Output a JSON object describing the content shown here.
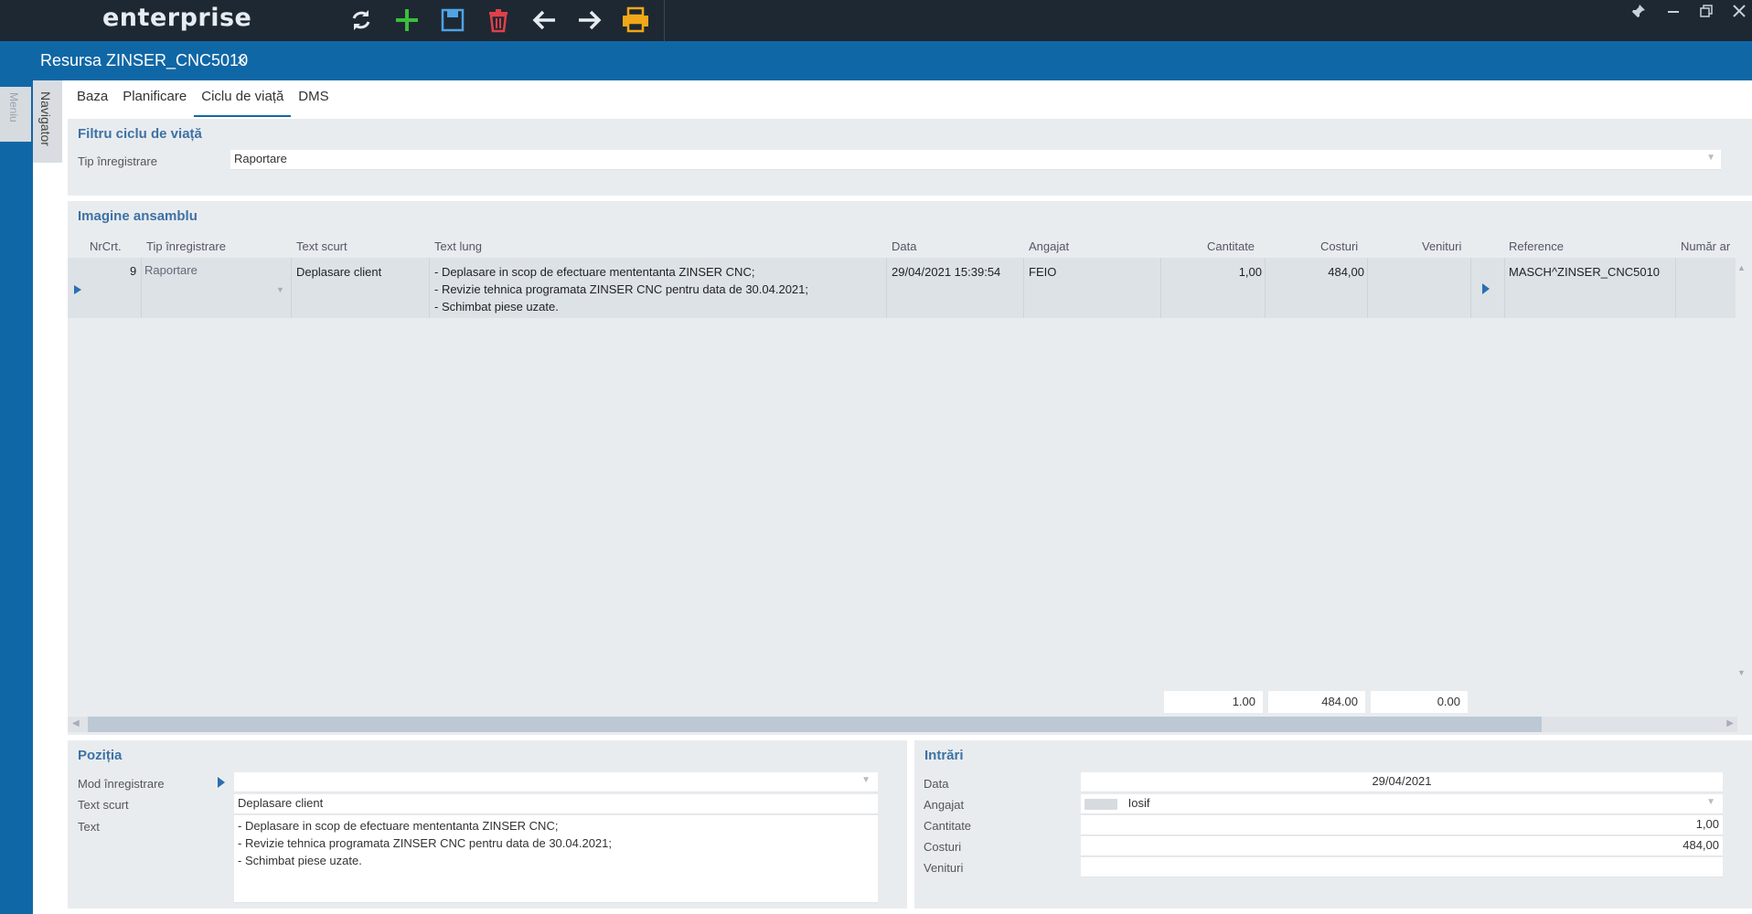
{
  "app": {
    "brand": "enterprise"
  },
  "toolbar": {
    "refresh_icon": "refresh-icon",
    "add_icon": "add-icon",
    "save_icon": "save-icon",
    "delete_icon": "delete-icon",
    "back_icon": "arrow-left-icon",
    "forward_icon": "arrow-right-icon",
    "print_icon": "printer-icon"
  },
  "rail": {
    "tab_label": "Meniu"
  },
  "document": {
    "title": "Resursa ZINSER_CNC5010",
    "close": "×"
  },
  "navigator": {
    "label": "Navigator"
  },
  "tabs": [
    {
      "label": "Baza"
    },
    {
      "label": "Planificare"
    },
    {
      "label": "Ciclu de viață"
    },
    {
      "label": "DMS"
    }
  ],
  "filter": {
    "title": "Filtru ciclu de viață",
    "type_label": "Tip înregistrare",
    "type_value": "Raportare"
  },
  "overview": {
    "title": "Imagine ansamblu",
    "columns": [
      "NrCrt.",
      "Tip înregistrare",
      "Text scurt",
      "Text lung",
      "Data",
      "Angajat",
      "Cantitate",
      "Costuri",
      "Venituri",
      "Reference",
      "Număr ar"
    ],
    "rows": [
      {
        "nr": "9",
        "type": "Raportare",
        "short_text": "Deplasare client",
        "long_text_1": "- Deplasare in scop de efectuare mententanta ZINSER CNC;",
        "long_text_2": "- Revizie tehnica programata ZINSER CNC pentru data de 30.04.2021;",
        "long_text_3": "- Schimbat piese uzate.",
        "date": "29/04/2021 15:39:54",
        "employee": "FEIO",
        "quantity": "1,00",
        "costs": "484,00",
        "revenue": "",
        "reference": "MASCH^ZINSER_CNC5010"
      }
    ],
    "totals": {
      "quantity": "1.00",
      "costs": "484.00",
      "revenue": "0.00"
    }
  },
  "position": {
    "title": "Poziția",
    "mode_label": "Mod înregistrare",
    "mode_value": "",
    "short_label": "Text scurt",
    "short_value": "Deplasare client",
    "text_label": "Text",
    "text_line_1": "- Deplasare in scop de efectuare mententanta ZINSER CNC;",
    "text_line_2": "- Revizie tehnica programata ZINSER CNC pentru data de 30.04.2021;",
    "text_line_3": "- Schimbat piese uzate."
  },
  "entries": {
    "title": "Intrări",
    "date_label": "Data",
    "date_value": "29/04/2021",
    "employee_label": "Angajat",
    "employee_value": "Iosif",
    "quantity_label": "Cantitate",
    "quantity_value": "1,00",
    "costs_label": "Costuri",
    "costs_value": "484,00",
    "revenue_label": "Venituri",
    "revenue_value": ""
  }
}
